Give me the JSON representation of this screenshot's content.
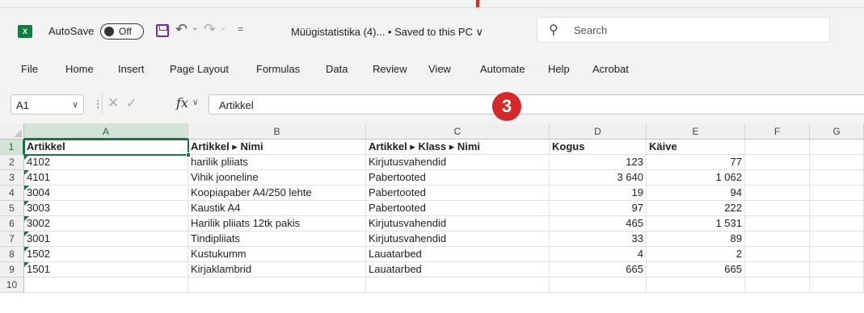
{
  "titlebar": {
    "app_icon": "excel-logo",
    "autosave_label": "AutoSave",
    "autosave_state": "Off",
    "doc_title": "Müügistatistika (4)... • Saved to this PC ∨",
    "search_placeholder": "Search"
  },
  "ribbon": {
    "tabs": [
      "File",
      "Home",
      "Insert",
      "Page Layout",
      "Formulas",
      "Data",
      "Review",
      "View",
      "Automate",
      "Help",
      "Acrobat"
    ]
  },
  "formula_bar": {
    "name_box": "A1",
    "fx": "fx",
    "value": "Artikkel"
  },
  "grid": {
    "columns": [
      "A",
      "B",
      "C",
      "D",
      "E",
      "F",
      "G"
    ],
    "rows": [
      "1",
      "2",
      "3",
      "4",
      "5",
      "6",
      "7",
      "8",
      "9",
      "10"
    ],
    "header": [
      "Artikkel",
      "Artikkel ▸ Nimi",
      "Artikkel ▸ Klass ▸ Nimi",
      "Kogus",
      "Käive"
    ],
    "data": [
      [
        "4102",
        "harilik pliiats",
        "Kirjutusvahendid",
        "123",
        "77"
      ],
      [
        "4101",
        "Vihik jooneline",
        "Pabertooted",
        "3 640",
        "1 062"
      ],
      [
        "3004",
        "Koopiapaber A4/250 lehte",
        "Pabertooted",
        "19",
        "94"
      ],
      [
        "3003",
        "Kaustik A4",
        "Pabertooted",
        "97",
        "222"
      ],
      [
        "3002",
        "Harilik pliiats 12tk pakis",
        "Kirjutusvahendid",
        "465",
        "1 531"
      ],
      [
        "3001",
        "Tindipliiats",
        "Kirjutusvahendid",
        "33",
        "89"
      ],
      [
        "1502",
        "Kustukumm",
        "Lauatarbed",
        "4",
        "2"
      ],
      [
        "1501",
        "Kirjaklambrid",
        "Lauatarbed",
        "665",
        "665"
      ]
    ],
    "active_cell": "A1"
  },
  "annotation": {
    "badge_number": "3",
    "color": "#d42a2a"
  },
  "colors": {
    "excel_green": "#1e7145",
    "save_purple": "#7a2b9c"
  }
}
